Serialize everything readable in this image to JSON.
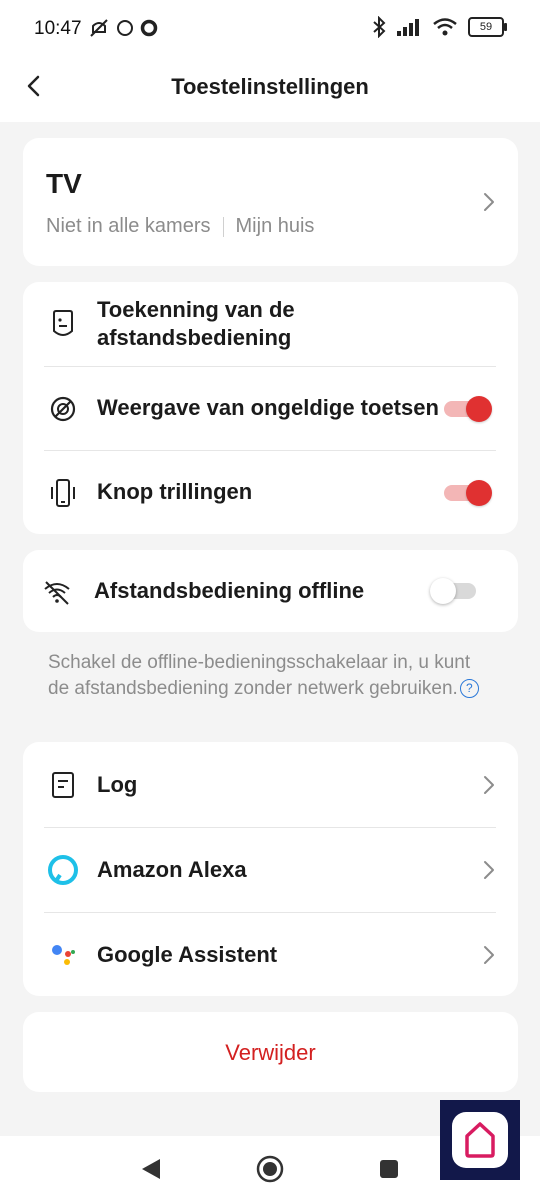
{
  "status_bar": {
    "time": "10:47",
    "battery": "59",
    "icons_left": [
      "mute-icon",
      "circle-icon",
      "ring-icon"
    ],
    "icons_right": [
      "bluetooth-icon",
      "signal-icon",
      "wifi-icon",
      "battery-icon"
    ]
  },
  "header": {
    "title": "Toestelinstellingen",
    "back_icon": "chevron-left-icon"
  },
  "device": {
    "name": "TV",
    "room": "Niet in alle kamers",
    "home": "Mijn huis"
  },
  "settings": {
    "remote_assignment": "Toekenning van de afstandsbediening",
    "invalid_keys_label": "Weergave van ongeldige toetsen",
    "invalid_keys_on": true,
    "vibration_label": "Knop trillingen",
    "vibration_on": true
  },
  "offline": {
    "label": "Afstandsbediening offline",
    "enabled": false,
    "hint": "Schakel de offline-bedieningsschakelaar in, u kunt de afstandsbediening zonder netwerk gebruiken."
  },
  "integrations": {
    "log": "Log",
    "alexa": "Amazon Alexa",
    "google": "Google Assistent"
  },
  "actions": {
    "remove": "Verwijder"
  },
  "colors": {
    "accent_red": "#e03131",
    "remove_red": "#d32020",
    "alexa_cyan": "#1ec0e8",
    "help_blue": "#2a78d8"
  }
}
